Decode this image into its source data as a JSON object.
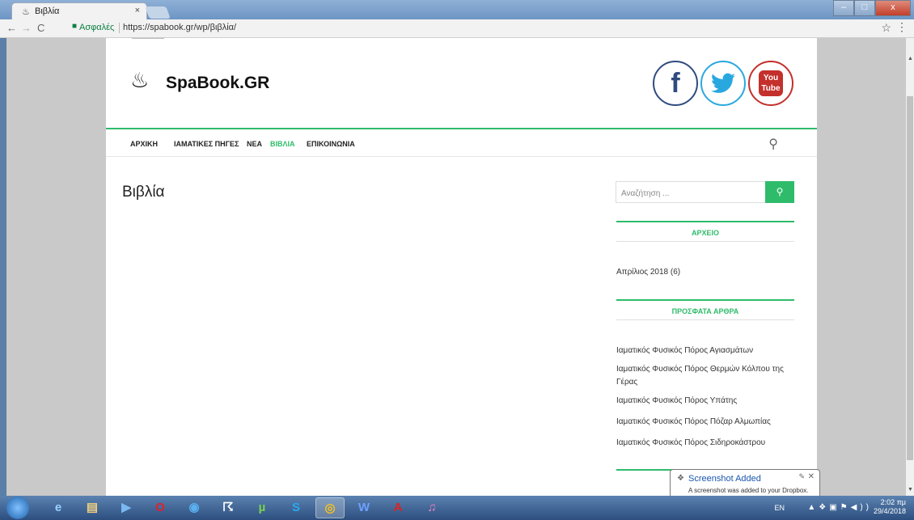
{
  "browser": {
    "tab_title": "Βιβλία",
    "tab_close": "×",
    "secure_label": "Ασφαλές",
    "url": "https://spabook.gr/wp/βιβλία/"
  },
  "site": {
    "logo_text": "SpaBook.GR",
    "logo_icon": "♨",
    "social": {
      "facebook": "f",
      "youtube_top": "You",
      "youtube_bottom": "Tube"
    },
    "nav": [
      "ΑΡΧΙΚΗ",
      "ΙΑΜΑΤΙΚΕΣ ΠΗΓΕΣ",
      "ΝΕΑ",
      "ΒΙΒΛΙΑ",
      "ΕΠΙΚΟΙΝΩΝΙΑ"
    ],
    "active_nav": "ΒΙΒΛΙΑ"
  },
  "main": {
    "page_title": "Βιβλία"
  },
  "sidebar": {
    "search_placeholder": "Αναζήτηση ...",
    "archive_title": "ΑΡΧΕΙΟ",
    "archive_item": "Απρίλιος 2018 (6)",
    "recent_title": "ΠΡΟΣΦΑΤΑ ΑΡΘΡΑ",
    "recent_posts": [
      "Ιαματικός Φυσικός Πόρος Αγιασμάτων",
      "Ιαματικός Φυσικός Πόρος Θερμών Κόλπου της Γέρας",
      "Ιαματικός Φυσικός Πόρος Υπάτης",
      "Ιαματικός Φυσικός Πόρος Πόζαρ Αλμωπίας",
      "Ιαματικός Φυσικός Πόρος Σιδηροκάστρου"
    ]
  },
  "toast": {
    "title": "Screenshot Added",
    "message": "A screenshot was added to your Dropbox."
  },
  "taskbar": {
    "lang": "EN",
    "time": "2:02 πμ",
    "date": "29/4/2018"
  },
  "colors": {
    "accent": "#2ebc6b",
    "facebook": "#2f4b7f",
    "twitter": "#29a8e0",
    "youtube": "#c4302b"
  }
}
